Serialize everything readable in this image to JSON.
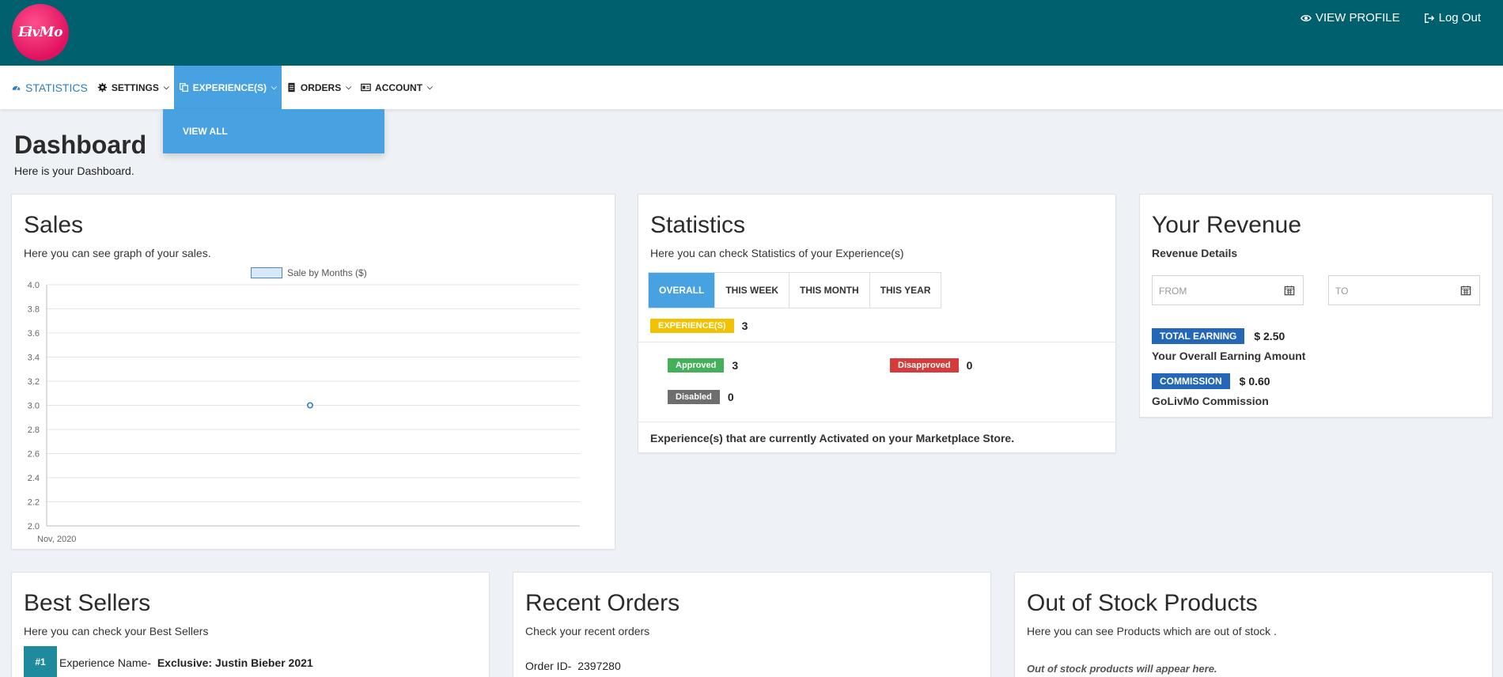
{
  "header": {
    "logo_text": "LivMo",
    "view_profile": "VIEW PROFILE",
    "logout": "Log Out"
  },
  "nav": {
    "items": [
      {
        "label": "STATISTICS",
        "icon": "dashboard-icon"
      },
      {
        "label": "SETTINGS",
        "icon": "gear-icon"
      },
      {
        "label": "EXPERIENCE(S)",
        "icon": "copy-icon"
      },
      {
        "label": "ORDERS",
        "icon": "document-icon"
      },
      {
        "label": "ACCOUNT",
        "icon": "id-card-icon"
      }
    ],
    "dropdown": {
      "item": "VIEW ALL"
    }
  },
  "page": {
    "title": "Dashboard",
    "subtitle": "Here is your Dashboard."
  },
  "sales": {
    "title": "Sales",
    "subtitle": "Here you can see graph of your sales."
  },
  "chart_data": {
    "type": "line",
    "title": "",
    "xlabel": "",
    "ylabel": "",
    "categories": [
      "Nov, 2020"
    ],
    "series": [
      {
        "name": "Sale by Months ($)",
        "values": [
          3.0
        ]
      }
    ],
    "ylim": [
      2.0,
      4.0
    ],
    "yticks": [
      "4.0",
      "3.8",
      "3.6",
      "3.4",
      "3.2",
      "3.0",
      "2.8",
      "2.6",
      "2.4",
      "2.2",
      "2.0"
    ],
    "grid": true,
    "legend": "top-center"
  },
  "statistics": {
    "title": "Statistics",
    "subtitle": "Here you can check Statistics of your Experience(s)",
    "tabs": [
      "OVERALL",
      "THIS WEEK",
      "THIS MONTH",
      "THIS YEAR"
    ],
    "experiences_label": "EXPERIENCE(S)",
    "experiences_count": "3",
    "approved_label": "Approved",
    "approved_count": "3",
    "disapproved_label": "Disapproved",
    "disapproved_count": "0",
    "disabled_label": "Disabled",
    "disabled_count": "0",
    "footer": "Experience(s) that are currently Activated on your Marketplace Store."
  },
  "revenue": {
    "title": "Your Revenue",
    "subtitle": "Revenue Details",
    "from_placeholder": "FROM",
    "to_placeholder": "TO",
    "total_label": "TOTAL EARNING",
    "total_value": "$ 2.50",
    "total_desc": "Your Overall Earning Amount",
    "commission_label": "COMMISSION",
    "commission_value": "$ 0.60",
    "commission_desc": "GoLivMo Commission"
  },
  "best_sellers": {
    "title": "Best Sellers",
    "subtitle": "Here you can check your Best Sellers",
    "rank": "#1",
    "name_label": "Experience Name-",
    "name_value": "Exclusive: Justin Bieber 2021"
  },
  "recent_orders": {
    "title": "Recent Orders",
    "subtitle": "Check your recent orders",
    "order_label": "Order ID-",
    "order_value": "2397280"
  },
  "out_of_stock": {
    "title": "Out of Stock Products",
    "subtitle": "Here you can see Products which are out of stock .",
    "empty": "Out of stock products will appear here."
  },
  "colors": {
    "header_bg": "#00606e",
    "accent": "#48a2e2",
    "logo": "#e0115f"
  }
}
